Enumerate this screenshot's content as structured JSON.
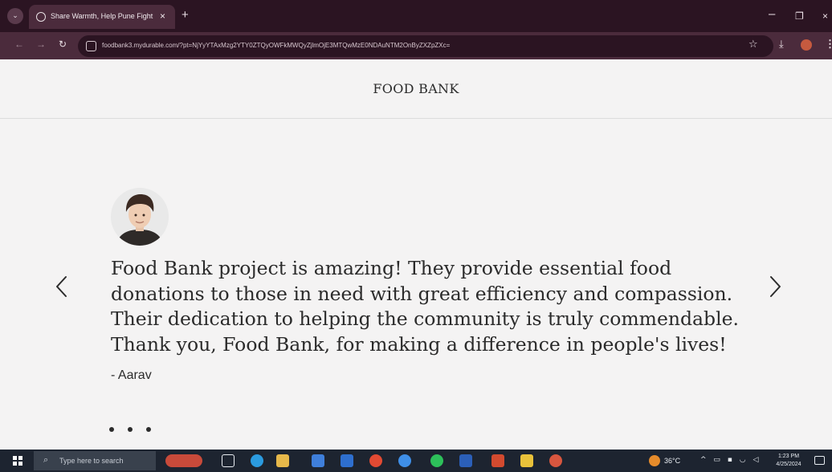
{
  "browser": {
    "tab_title": "Share Warmth, Help Pune Fight",
    "url": "foodbank3.mydurable.com/?pt=NjYyYTAxMzg2YTY0ZTQyOWFkMWQyZjlmOjE3MTQwMzE0NDAuNTM2OnByZXZpZXc="
  },
  "site": {
    "title": "FOOD BANK"
  },
  "testimonial": {
    "quote_lines": [
      "Food Bank project is amazing! They provide essential food",
      "donations to those in need with great efficiency and compassion.",
      "Their dedication to helping the community is truly commendable.",
      "Thank you, Food Bank, for making a difference in people's lives!"
    ],
    "author": "- Aarav",
    "slide_count": 3
  },
  "icons": {
    "prev": "chevron-left-icon",
    "next": "chevron-right-icon",
    "avatar": "person-avatar"
  },
  "taskbar": {
    "search_placeholder": "Type here to search",
    "temperature": "36°C",
    "time": "1:23 PM",
    "date": "4/25/2024"
  },
  "colors": {
    "browser_dark": "#2b1422",
    "browser_toolbar": "#4b2b3c",
    "page_bg": "#f4f3f3",
    "text": "#2b2b2b",
    "taskbar": "#1d2430"
  }
}
